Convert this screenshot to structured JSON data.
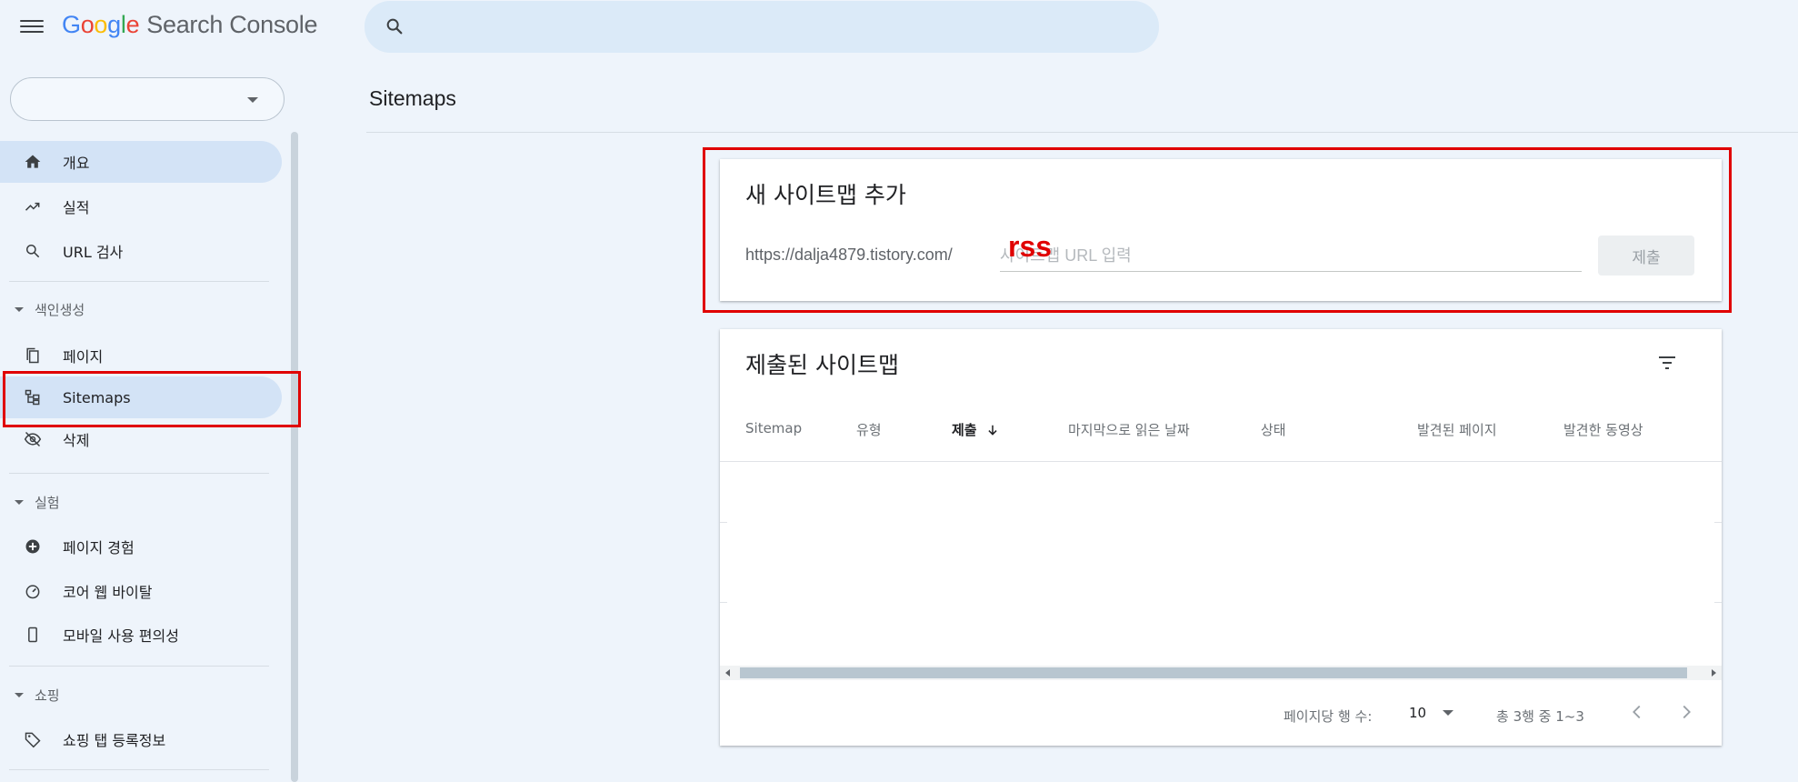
{
  "header": {
    "logo_letters": [
      "G",
      "o",
      "o",
      "g",
      "l",
      "e"
    ],
    "product_name": "Search Console",
    "search_placeholder": ""
  },
  "property_selector": {
    "value": ""
  },
  "sidebar": {
    "items": [
      {
        "label": "개요",
        "icon": "home-icon"
      },
      {
        "label": "실적",
        "icon": "trending-up-icon"
      },
      {
        "label": "URL 검사",
        "icon": "search-icon"
      }
    ],
    "sections": [
      {
        "title": "색인생성",
        "items": [
          {
            "label": "페이지",
            "icon": "pages-icon"
          },
          {
            "label": "Sitemaps",
            "icon": "sitemap-icon"
          },
          {
            "label": "삭제",
            "icon": "visibility-off-icon"
          }
        ]
      },
      {
        "title": "실험",
        "items": [
          {
            "label": "페이지 경험",
            "icon": "add-circle-icon"
          },
          {
            "label": "코어 웹 바이탈",
            "icon": "speed-icon"
          },
          {
            "label": "모바일 사용 편의성",
            "icon": "smartphone-icon"
          }
        ]
      },
      {
        "title": "쇼핑",
        "items": [
          {
            "label": "쇼핑 탭 등록정보",
            "icon": "tag-icon"
          }
        ]
      }
    ]
  },
  "main": {
    "page_title": "Sitemaps",
    "add_sitemap": {
      "title": "새 사이트맵 추가",
      "url_prefix": "https://dalja4879.tistory.com/",
      "input_placeholder": "사이트맵 URL 입력",
      "annotation": "rss",
      "submit_label": "제출"
    },
    "submitted_sitemaps": {
      "title": "제출된 사이트맵",
      "columns": [
        "Sitemap",
        "유형",
        "제출",
        "마지막으로 읽은 날짜",
        "상태",
        "발견된 페이지",
        "발견한 동영상"
      ],
      "rows": [],
      "rows_per_page_label": "페이지당 행 수:",
      "rows_per_page": "10",
      "range_label": "총 3행 중 1~3"
    }
  },
  "colors": {
    "background": "#eef4fb",
    "active_nav": "#d3e3f6",
    "annotation_red": "#e00000"
  }
}
